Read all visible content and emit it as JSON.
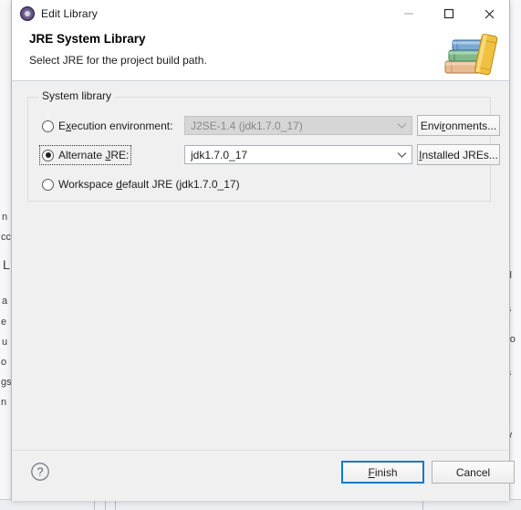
{
  "window": {
    "title": "Edit Library",
    "icon": "eclipse-library-icon",
    "controls": {
      "minimize": "minimize-icon",
      "maximize": "maximize-icon",
      "close": "close-icon"
    }
  },
  "header": {
    "title": "JRE System Library",
    "subtitle": "Select JRE for the project build path.",
    "icon": "books-stack-icon"
  },
  "group": {
    "legend": "System library",
    "options": [
      {
        "id": "execution-environment",
        "label": "Execution environment:",
        "label_pre": "E",
        "label_mnemonic": "x",
        "label_post": "ecution environment:",
        "selected": false,
        "enabled": false,
        "combo_value": "J2SE-1.4 (jdk1.7.0_17)",
        "button_label": "Environments...",
        "button_pre": "Envi",
        "button_mnemonic": "r",
        "button_post": "onments..."
      },
      {
        "id": "alternate-jre",
        "label": "Alternate JRE:",
        "label_pre": "Alternate ",
        "label_mnemonic": "J",
        "label_post": "RE:",
        "selected": true,
        "enabled": true,
        "focused": true,
        "combo_value": "jdk1.7.0_17",
        "button_label": "Installed JREs...",
        "button_pre": "",
        "button_mnemonic": "I",
        "button_post": "nstalled JREs..."
      },
      {
        "id": "workspace-default-jre",
        "label": "Workspace default JRE (jdk1.7.0_17)",
        "label_pre": "Workspace ",
        "label_mnemonic": "d",
        "label_post": "efault JRE (jdk1.7.0_17)",
        "selected": false,
        "enabled": true
      }
    ]
  },
  "footer": {
    "help_icon": "help-circle-icon",
    "finish_label": "Finish",
    "finish_pre": "",
    "finish_mnemonic": "F",
    "finish_post": "inish",
    "cancel_label": "Cancel"
  },
  "background_fragments": {
    "left": [
      "n",
      "cc",
      "L",
      "a",
      "e",
      "u",
      "o",
      "gs",
      "n"
    ],
    "right": [
      "il",
      "sl",
      "a",
      "Fo",
      "a",
      "t",
      "w"
    ]
  },
  "colors": {
    "accent": "#1a78c2",
    "dialog_bg": "#f0f0f0",
    "header_bg": "#ffffff",
    "disabled_bg": "#d6d6d6",
    "disabled_text": "#888888",
    "text": "#1c1c1c"
  }
}
